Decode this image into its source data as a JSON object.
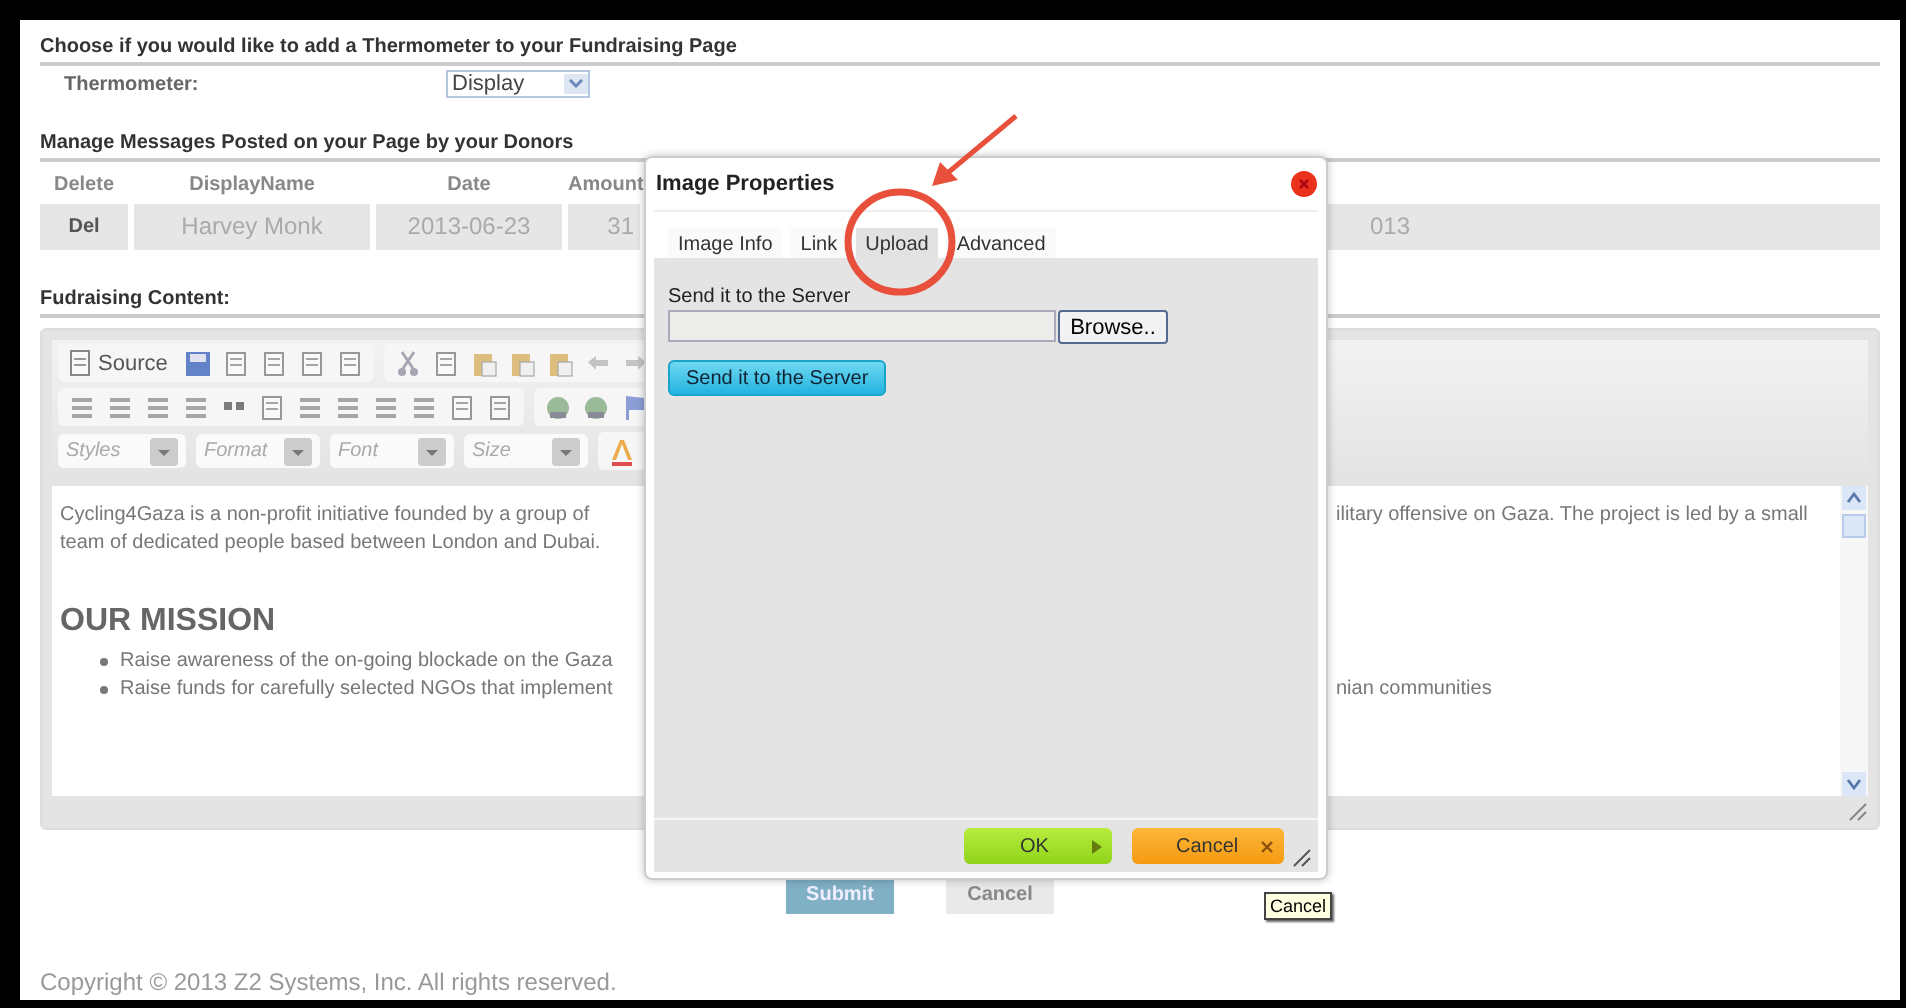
{
  "thermometer_section": {
    "heading": "Choose if you would like to add a Thermometer to your Fundraising Page",
    "label": "Thermometer:",
    "select": {
      "value": "Display"
    }
  },
  "messages_section": {
    "heading": "Manage Messages Posted on your Page by your Donors",
    "columns": [
      "Delete",
      "DisplayName",
      "Date",
      "Amount"
    ],
    "rows": [
      {
        "cells": [
          "Del",
          "Harvey Monk",
          "2013-06-23",
          "31"
        ],
        "trailing": "013"
      }
    ]
  },
  "content_section": {
    "heading": "Fudraising Content:",
    "editor": {
      "source_button": "Source",
      "combos": [
        {
          "placeholder": "Styles"
        },
        {
          "placeholder": "Format"
        },
        {
          "placeholder": "Font"
        },
        {
          "placeholder": "Size"
        }
      ],
      "lines": [
        {
          "kind": "paragraph",
          "left": "Cycling4Gaza is a non-profit initiative founded by a group of",
          "right": "ilitary offensive on Gaza. The project is led by a small"
        },
        {
          "kind": "paragraph",
          "left": "team of dedicated people based between London and Dubai."
        },
        {
          "kind": "heading",
          "left": "OUR MISSION"
        },
        {
          "kind": "bullet",
          "left": "Raise awareness of the on-going blockade on the Gaza"
        },
        {
          "kind": "bullet",
          "left": "Raise funds for carefully selected NGOs that implement",
          "right": "nian communities"
        }
      ]
    }
  },
  "buttons": [
    {
      "label": "Submit",
      "kind": "primary"
    },
    {
      "label": "Cancel",
      "kind": "secondary"
    }
  ],
  "footer": "Copyright © 2013 Z2 Systems, Inc. All rights reserved.",
  "dialog": {
    "title": "Image Properties",
    "tabs": [
      {
        "label": "Image Info",
        "selected": false
      },
      {
        "label": "Link",
        "selected": false
      },
      {
        "label": "Upload",
        "selected": true
      },
      {
        "label": "Advanced",
        "selected": false
      }
    ],
    "field_label": "Send it to the Server",
    "browse_button": "Browse..",
    "send_button": "Send it to the Server",
    "ok_button": "OK",
    "cancel_button": "Cancel"
  },
  "tooltip": "Cancel"
}
